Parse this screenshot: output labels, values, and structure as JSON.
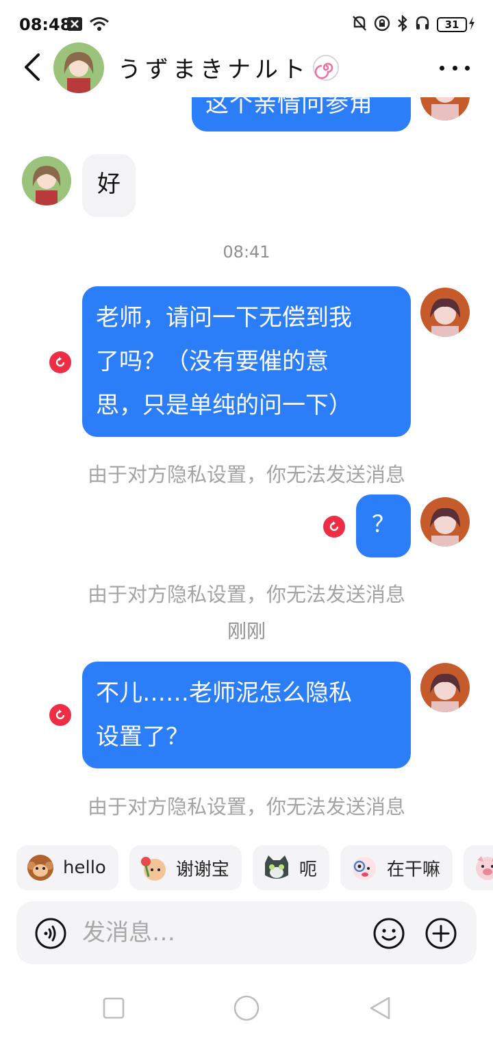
{
  "status_bar": {
    "time": "08:48",
    "battery": "31"
  },
  "header": {
    "contact_name": "うずまきナルト"
  },
  "messages": {
    "partial_top_text": "这个亲情问参角",
    "in_reply": "好",
    "timestamp_1": "08:41",
    "msg1_line1": "老师，请问一下无偿到我",
    "msg1_line2": "了吗？（没有要催的意",
    "msg1_line3": "思，只是单纯的问一下）",
    "blocked_note": "由于对方隐私设置，你无法发送消息",
    "msg2": "？",
    "timestamp_2": "刚刚",
    "msg3_line1": "不儿……老师泥怎么隐私",
    "msg3_line2": "设置了？"
  },
  "quick_replies": [
    {
      "label": "hello",
      "icon": "monkey-emoji-icon"
    },
    {
      "label": "谢谢宝",
      "icon": "flower-emoji-icon"
    },
    {
      "label": "呃",
      "icon": "cat-emoji-icon"
    },
    {
      "label": "在干嘛",
      "icon": "peek-emoji-icon"
    },
    {
      "label": "",
      "icon": "pig-emoji-icon"
    }
  ],
  "input": {
    "placeholder": "发消息…"
  },
  "colors": {
    "bubble_out": "#2c7ef8",
    "bubble_in": "#f3f3f5",
    "error_red": "#ef2d45"
  }
}
